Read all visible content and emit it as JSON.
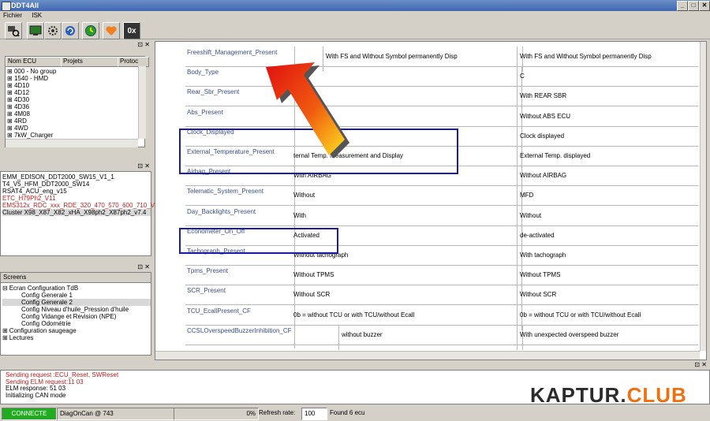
{
  "window": {
    "title": "DDT4All",
    "minimize": "_",
    "maximize": "□",
    "close": "✕"
  },
  "menu": [
    "Fichier",
    "ISK"
  ],
  "toolbar": {
    "zoom_label": "0x"
  },
  "ecu_panel": {
    "columns": [
      "Nom ECU",
      "Projets",
      "Protoc"
    ],
    "items": [
      "000 - No group",
      "1540 - HMD",
      "4D10",
      "4D12",
      "4D30",
      "4D36",
      "4M08",
      "4RD",
      "4WD",
      "7kW_Charger"
    ]
  },
  "file_panel": {
    "items": [
      {
        "text": "EMM_EDISON_DDT2000_SW15_V1_1",
        "color": "#000000"
      },
      {
        "text": "T4_V5_HFM_DDT2000_SW14",
        "color": "#000000"
      },
      {
        "text": "RSAT4_ACU_eng_v15",
        "color": "#000000"
      },
      {
        "text": "ETC_H79Ph2_V11",
        "color": "#c02020"
      },
      {
        "text": "EMS312x_RDC_xxx_RDE_320_470_570_600_710_V01",
        "color": "#c02020"
      },
      {
        "text": "Cluster X98_X87_X82_xHA_X98ph2_X87ph2_v7.4",
        "color": "#000000"
      }
    ]
  },
  "screens_panel": {
    "header": "Screens",
    "items": [
      {
        "text": "Ecran Configuration TdB",
        "level": 0,
        "expander": "⊟"
      },
      {
        "text": "Config Generale 1",
        "level": 1,
        "expander": ""
      },
      {
        "text": "Config Generale 2",
        "level": 1,
        "expander": "",
        "selected": true
      },
      {
        "text": "Config Niveau d'huile_Pression d'huile",
        "level": 1,
        "expander": ""
      },
      {
        "text": "Config Vidange et Revision (NPE)",
        "level": 1,
        "expander": ""
      },
      {
        "text": "Config Odométrie",
        "level": 1,
        "expander": ""
      },
      {
        "text": "Configuration saugeage",
        "level": 0,
        "expander": "⊞"
      },
      {
        "text": "Lectures",
        "level": 0,
        "expander": "⊞"
      }
    ]
  },
  "params": [
    {
      "name": "Freeshift_Management_Present",
      "val1": "With FS and Without Symbol permanently Disp",
      "val2": "With FS and Without Symbol permanently Disp"
    },
    {
      "name": "Body_Type",
      "val1": "",
      "val2": "C"
    },
    {
      "name": "Rear_Sbr_Present",
      "val1": "AR SBR",
      "val2": "With REAR SBR"
    },
    {
      "name": "Abs_Present",
      "val1": "",
      "val2": "Without ABS ECU"
    },
    {
      "name": "Clock_Displayed",
      "val1": "",
      "val2": "Clock displayed"
    },
    {
      "name": "External_Temperature_Present",
      "val1": "ternal Temp. Measurement and Display",
      "val2": "External Temp. displayed"
    },
    {
      "name": "Airbag_Present",
      "val1": "With AIRBAG",
      "val2": "Without AIRBAG"
    },
    {
      "name": "Telematic_System_Present",
      "val1": "Without",
      "val2": "MFD"
    },
    {
      "name": "Day_Backlights_Present",
      "val1": "With",
      "val2": "Without"
    },
    {
      "name": "Econometer_On_Off",
      "val1": "Activated",
      "val2": "de-activated"
    },
    {
      "name": "Tachograph_Present",
      "val1": "Without tachograph",
      "val2": "With tachograph"
    },
    {
      "name": "Tpms_Present",
      "val1": "Without TPMS",
      "val2": "Without TPMS"
    },
    {
      "name": "SCR_Present",
      "val1": "Without SCR",
      "val2": "Without SCR"
    },
    {
      "name": "TCU_EcallPresent_CF",
      "val1": "0b = without TCU or with TCU/without Ecall",
      "val2": "0b = without TCU or with TCU/without Ecall"
    },
    {
      "name": "CCSLOverspeedBuzzerInhibition_CF",
      "val1": "without buzzer",
      "val2": "With unexpected overspeed buzzer"
    }
  ],
  "log": [
    {
      "text": "Sending request :ECU_Reset, SWReset",
      "color": "#c02020"
    },
    {
      "text": "Sending ELM request:11 03",
      "color": "#c02020"
    },
    {
      "text": "ELM response: 51 03",
      "color": "#000000"
    },
    {
      "text": "Initializing CAN mode",
      "color": "#000000"
    }
  ],
  "status": {
    "connected": "CONNECTE",
    "adapter": "DiagOnCan @ 743",
    "progress": "0%",
    "refresh_label": "Refresh rate:",
    "refresh_value": "100",
    "found": "Found 6 ecu"
  },
  "watermark": "KAPTUR.CLUB",
  "colors": {
    "accent_box": "#1a1aa8",
    "connected_bg": "#22aa22",
    "arrow_red": "#e01010",
    "arrow_yellow": "#ffe020"
  }
}
